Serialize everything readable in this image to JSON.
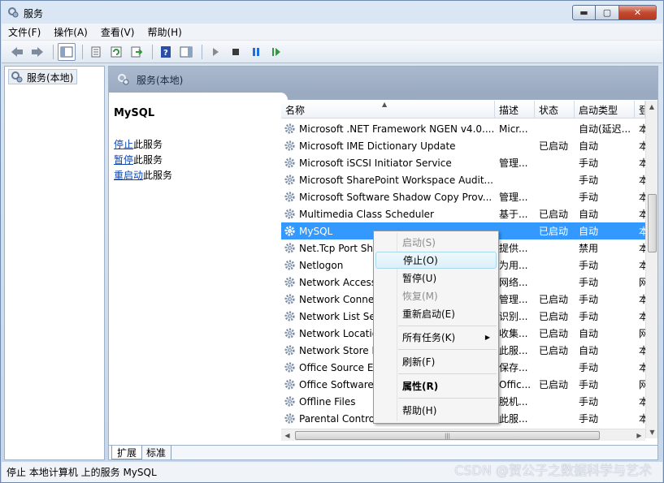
{
  "window": {
    "title": "服务",
    "min_glyph": "▬",
    "max_glyph": "▢",
    "close_glyph": "✕"
  },
  "menubar": [
    "文件(F)",
    "操作(A)",
    "查看(V)",
    "帮助(H)"
  ],
  "tree": {
    "root": "服务(本地)"
  },
  "panel": {
    "header": "服务(本地)"
  },
  "detail": {
    "title": "MySQL",
    "stop_link": "停止",
    "stop_suffix": "此服务",
    "pause_link": "暂停",
    "pause_suffix": "此服务",
    "restart_link": "重启动",
    "restart_suffix": "此服务"
  },
  "table": {
    "columns": [
      "名称",
      "描述",
      "状态",
      "启动类型",
      "登"
    ],
    "rows": [
      [
        "Microsoft .NET Framework NGEN v4.0....",
        "Micr...",
        "",
        "自动(延迟...",
        "本"
      ],
      [
        "Microsoft IME Dictionary Update",
        "",
        "已启动",
        "自动",
        "本"
      ],
      [
        "Microsoft iSCSI Initiator Service",
        "管理...",
        "",
        "手动",
        "本"
      ],
      [
        "Microsoft SharePoint Workspace Audit...",
        "",
        "",
        "手动",
        "本"
      ],
      [
        "Microsoft Software Shadow Copy Prov...",
        "管理...",
        "",
        "手动",
        "本"
      ],
      [
        "Multimedia Class Scheduler",
        "基于...",
        "已启动",
        "自动",
        "本"
      ],
      [
        "MySQL",
        "",
        "已启动",
        "自动",
        "本"
      ],
      [
        "Net.Tcp Port Sh",
        "提供...",
        "",
        "禁用",
        "本"
      ],
      [
        "Netlogon",
        "为用...",
        "",
        "手动",
        "本"
      ],
      [
        "Network Access",
        "网络...",
        "",
        "手动",
        "网"
      ],
      [
        "Network Conne",
        "管理...",
        "已启动",
        "手动",
        "本"
      ],
      [
        "Network List Se",
        "识别...",
        "已启动",
        "手动",
        "本"
      ],
      [
        "Network Locatio",
        "收集...",
        "已启动",
        "自动",
        "网"
      ],
      [
        "Network Store I",
        "此服...",
        "已启动",
        "自动",
        "本"
      ],
      [
        "Office  Source E",
        "保存...",
        "",
        "手动",
        "本"
      ],
      [
        "Office Software",
        "Offic...",
        "已启动",
        "手动",
        "网"
      ],
      [
        "Offline Files",
        "脱机...",
        "",
        "手动",
        "本"
      ],
      [
        "Parental Contro",
        "此服...",
        "",
        "手动",
        "本"
      ]
    ],
    "selected_index": 6
  },
  "tabs": [
    "扩展",
    "标准"
  ],
  "context_menu": [
    {
      "label": "启动(S)",
      "state": "disabled"
    },
    {
      "label": "停止(O)",
      "state": "hover"
    },
    {
      "label": "暂停(U)",
      "state": "normal"
    },
    {
      "label": "恢复(M)",
      "state": "disabled"
    },
    {
      "label": "重新启动(E)",
      "state": "normal"
    },
    {
      "label": "所有任务(K)",
      "state": "submenu"
    },
    {
      "label": "刷新(F)",
      "state": "normal"
    },
    {
      "label": "属性(R)",
      "state": "bold"
    },
    {
      "label": "帮助(H)",
      "state": "normal"
    }
  ],
  "statusbar": "停止 本地计算机 上的服务 MySQL",
  "watermark": "CSDN @贺公子之数据科学与艺术",
  "colors": {
    "selection": "#3399ff",
    "link": "#0a46b4",
    "header": "#9aaac1"
  }
}
